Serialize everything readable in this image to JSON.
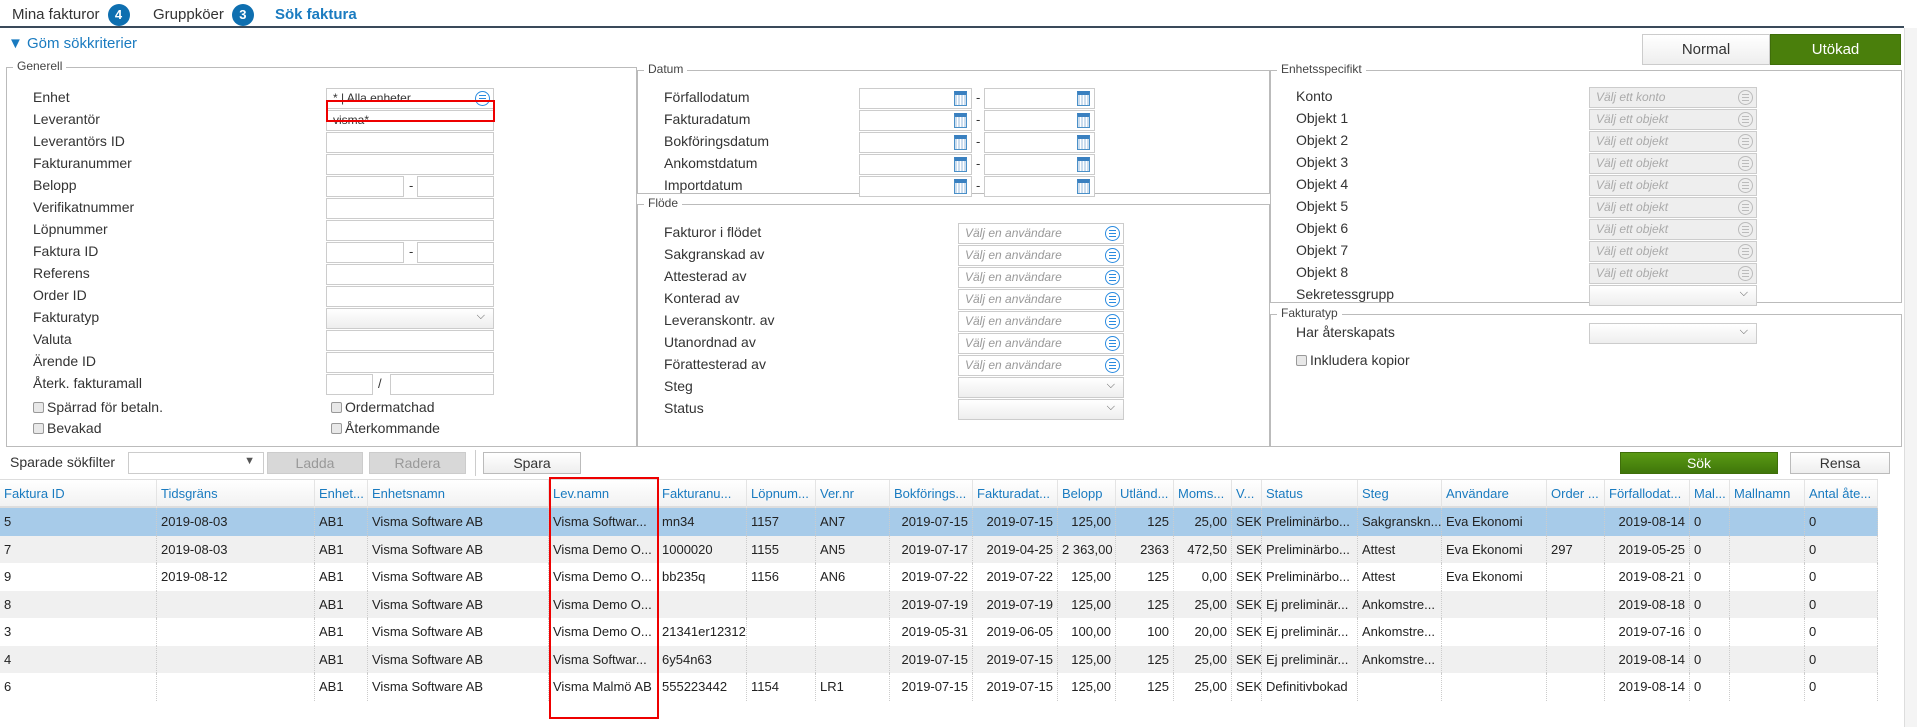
{
  "tabs": [
    {
      "label": "Mina fakturor",
      "badge": "4"
    },
    {
      "label": "Gruppköer",
      "badge": "3"
    },
    {
      "label": "Sök faktura",
      "badge": null
    }
  ],
  "toggle_label": "▼ Göm sökkriterier",
  "mode_buttons": {
    "normal": "Normal",
    "extended": "Utökad"
  },
  "colors": {
    "accent": "#1a7bc0",
    "green": "#4a7f0c",
    "selected_row": "#a7cbe9",
    "highlight": "#e00000"
  },
  "generell": {
    "legend": "Generell",
    "rows": [
      {
        "label": "Enhet",
        "type": "list",
        "value": "* | Alla enheter"
      },
      {
        "label": "Leverantör",
        "type": "text",
        "value": "visma*"
      },
      {
        "label": "Leverantörs ID",
        "type": "text",
        "value": ""
      },
      {
        "label": "Fakturanummer",
        "type": "text",
        "value": ""
      },
      {
        "label": "Belopp",
        "type": "range",
        "sep": "-"
      },
      {
        "label": "Verifikatnummer",
        "type": "text",
        "value": ""
      },
      {
        "label": "Löpnummer",
        "type": "text",
        "value": ""
      },
      {
        "label": "Faktura ID",
        "type": "range",
        "sep": "-"
      },
      {
        "label": "Referens",
        "type": "text",
        "value": ""
      },
      {
        "label": "Order ID",
        "type": "text",
        "value": ""
      },
      {
        "label": "Fakturatyp",
        "type": "select",
        "value": ""
      },
      {
        "label": "Valuta",
        "type": "text",
        "value": ""
      },
      {
        "label": "Ärende ID",
        "type": "text",
        "value": ""
      },
      {
        "label": "Återk. fakturamall",
        "type": "split",
        "sep": "/"
      }
    ],
    "checkboxes": [
      "Spärrad för betaln.",
      "Ordermatchad",
      "Bevakad",
      "Återkommande"
    ]
  },
  "datum": {
    "legend": "Datum",
    "rows": [
      "Förfallodatum",
      "Fakturadatum",
      "Bokföringsdatum",
      "Ankomstdatum",
      "Importdatum"
    ],
    "sep": "-"
  },
  "flode": {
    "legend": "Flöde",
    "placeholder": "Välj en användare",
    "rows": [
      "Fakturor i flödet",
      "Sakgranskad av",
      "Attesterad av",
      "Konterad av",
      "Leveranskontr. av",
      "Utanordnad av",
      "Förattesterad av"
    ],
    "selects": [
      "Steg",
      "Status"
    ]
  },
  "enhetsspecifikt": {
    "legend": "Enhetsspecifikt",
    "rows": [
      {
        "label": "Konto",
        "placeholder": "Välj ett konto"
      },
      {
        "label": "Objekt 1",
        "placeholder": "Välj ett objekt"
      },
      {
        "label": "Objekt 2",
        "placeholder": "Välj ett objekt"
      },
      {
        "label": "Objekt 3",
        "placeholder": "Välj ett objekt"
      },
      {
        "label": "Objekt 4",
        "placeholder": "Välj ett objekt"
      },
      {
        "label": "Objekt 5",
        "placeholder": "Välj ett objekt"
      },
      {
        "label": "Objekt 6",
        "placeholder": "Välj ett objekt"
      },
      {
        "label": "Objekt 7",
        "placeholder": "Välj ett objekt"
      },
      {
        "label": "Objekt 8",
        "placeholder": "Välj ett objekt"
      }
    ],
    "select_label": "Sekretessgrupp"
  },
  "fakturatyp": {
    "legend": "Fakturatyp",
    "select_label": "Har återskapats",
    "checkbox": "Inkludera kopior"
  },
  "toolbar": {
    "filter_label": "Sparade sökfilter",
    "load": "Ladda",
    "delete": "Radera",
    "save": "Spara",
    "search": "Sök",
    "clear": "Rensa"
  },
  "table": {
    "columns": [
      "Faktura ID",
      "Tidsgräns",
      "Enhet...",
      "Enhetsnamn",
      "Lev.namn",
      "Fakturanu...",
      "Löpnum...",
      "Ver.nr",
      "Bokförings...",
      "Fakturadat...",
      "Belopp",
      "Utländ...",
      "Moms...",
      "V...",
      "Status",
      "Steg",
      "Användare",
      "Order ...",
      "Förfallodat...",
      "Mal...",
      "Mallnamn",
      "Antal åte..."
    ],
    "rows": [
      [
        "5",
        "2019-08-03",
        "AB1",
        "Visma Software AB",
        "Visma Softwar...",
        "mn34",
        "1157",
        "AN7",
        "2019-07-15",
        "2019-07-15",
        "125,00",
        "125",
        "25,00",
        "SEK",
        "Preliminärbo...",
        "Sakgranskn...",
        "Eva Ekonomi",
        "",
        "2019-08-14",
        "0",
        "",
        "0"
      ],
      [
        "7",
        "2019-08-03",
        "AB1",
        "Visma Software AB",
        "Visma Demo O...",
        "1000020",
        "1155",
        "AN5",
        "2019-07-17",
        "2019-04-25",
        "2 363,00",
        "2363",
        "472,50",
        "SEK",
        "Preliminärbo...",
        "Attest",
        "Eva Ekonomi",
        "297",
        "2019-05-25",
        "0",
        "",
        "0"
      ],
      [
        "9",
        "2019-08-12",
        "AB1",
        "Visma Software AB",
        "Visma Demo O...",
        "bb235q",
        "1156",
        "AN6",
        "2019-07-22",
        "2019-07-22",
        "125,00",
        "125",
        "0,00",
        "SEK",
        "Preliminärbo...",
        "Attest",
        "Eva Ekonomi",
        "",
        "2019-08-21",
        "0",
        "",
        "0"
      ],
      [
        "8",
        "",
        "AB1",
        "Visma Software AB",
        "Visma Demo O...",
        "",
        "",
        "",
        "2019-07-19",
        "2019-07-19",
        "125,00",
        "125",
        "25,00",
        "SEK",
        "Ej preliminär...",
        "Ankomstre...",
        "",
        "",
        "2019-08-18",
        "0",
        "",
        "0"
      ],
      [
        "3",
        "",
        "AB1",
        "Visma Software AB",
        "Visma Demo O...",
        "21341er12312",
        "",
        "",
        "2019-05-31",
        "2019-06-05",
        "100,00",
        "100",
        "20,00",
        "SEK",
        "Ej preliminär...",
        "Ankomstre...",
        "",
        "",
        "2019-07-16",
        "0",
        "",
        "0"
      ],
      [
        "4",
        "",
        "AB1",
        "Visma Software AB",
        "Visma Softwar...",
        "6y54n63",
        "",
        "",
        "2019-07-15",
        "2019-07-15",
        "125,00",
        "125",
        "25,00",
        "SEK",
        "Ej preliminär...",
        "Ankomstre...",
        "",
        "",
        "2019-08-14",
        "0",
        "",
        "0"
      ],
      [
        "6",
        "",
        "AB1",
        "Visma Software AB",
        "Visma Malmö AB",
        "555223442",
        "1154",
        "LR1",
        "2019-07-15",
        "2019-07-15",
        "125,00",
        "125",
        "25,00",
        "SEK",
        "Definitivbokad",
        "",
        "",
        "",
        "2019-08-14",
        "0",
        "",
        "0"
      ]
    ],
    "selected_row": 0
  }
}
